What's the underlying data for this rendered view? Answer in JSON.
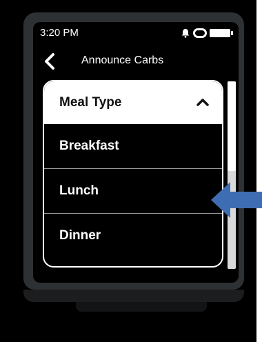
{
  "status_bar": {
    "time": "3:20 PM",
    "icons": [
      "bell-icon",
      "ring-icon",
      "battery-icon"
    ]
  },
  "header": {
    "back_icon": "chevron-left-icon",
    "title": "Announce Carbs"
  },
  "dropdown": {
    "label": "Meal Type",
    "state": "expanded",
    "toggle_icon": "chevron-up-icon",
    "options": [
      {
        "label": "Breakfast"
      },
      {
        "label": "Lunch"
      },
      {
        "label": "Dinner"
      }
    ]
  },
  "annotation": {
    "pointer_icon": "arrow-left-icon",
    "points_to_option": "Lunch",
    "color": "#3f6db3"
  },
  "colors": {
    "screen_background": "#000000",
    "bezel": "#2e3133",
    "dropdown_header": "#ffffff",
    "text_primary": "#ffffff",
    "annotation_arrow": "#3f6db3"
  }
}
